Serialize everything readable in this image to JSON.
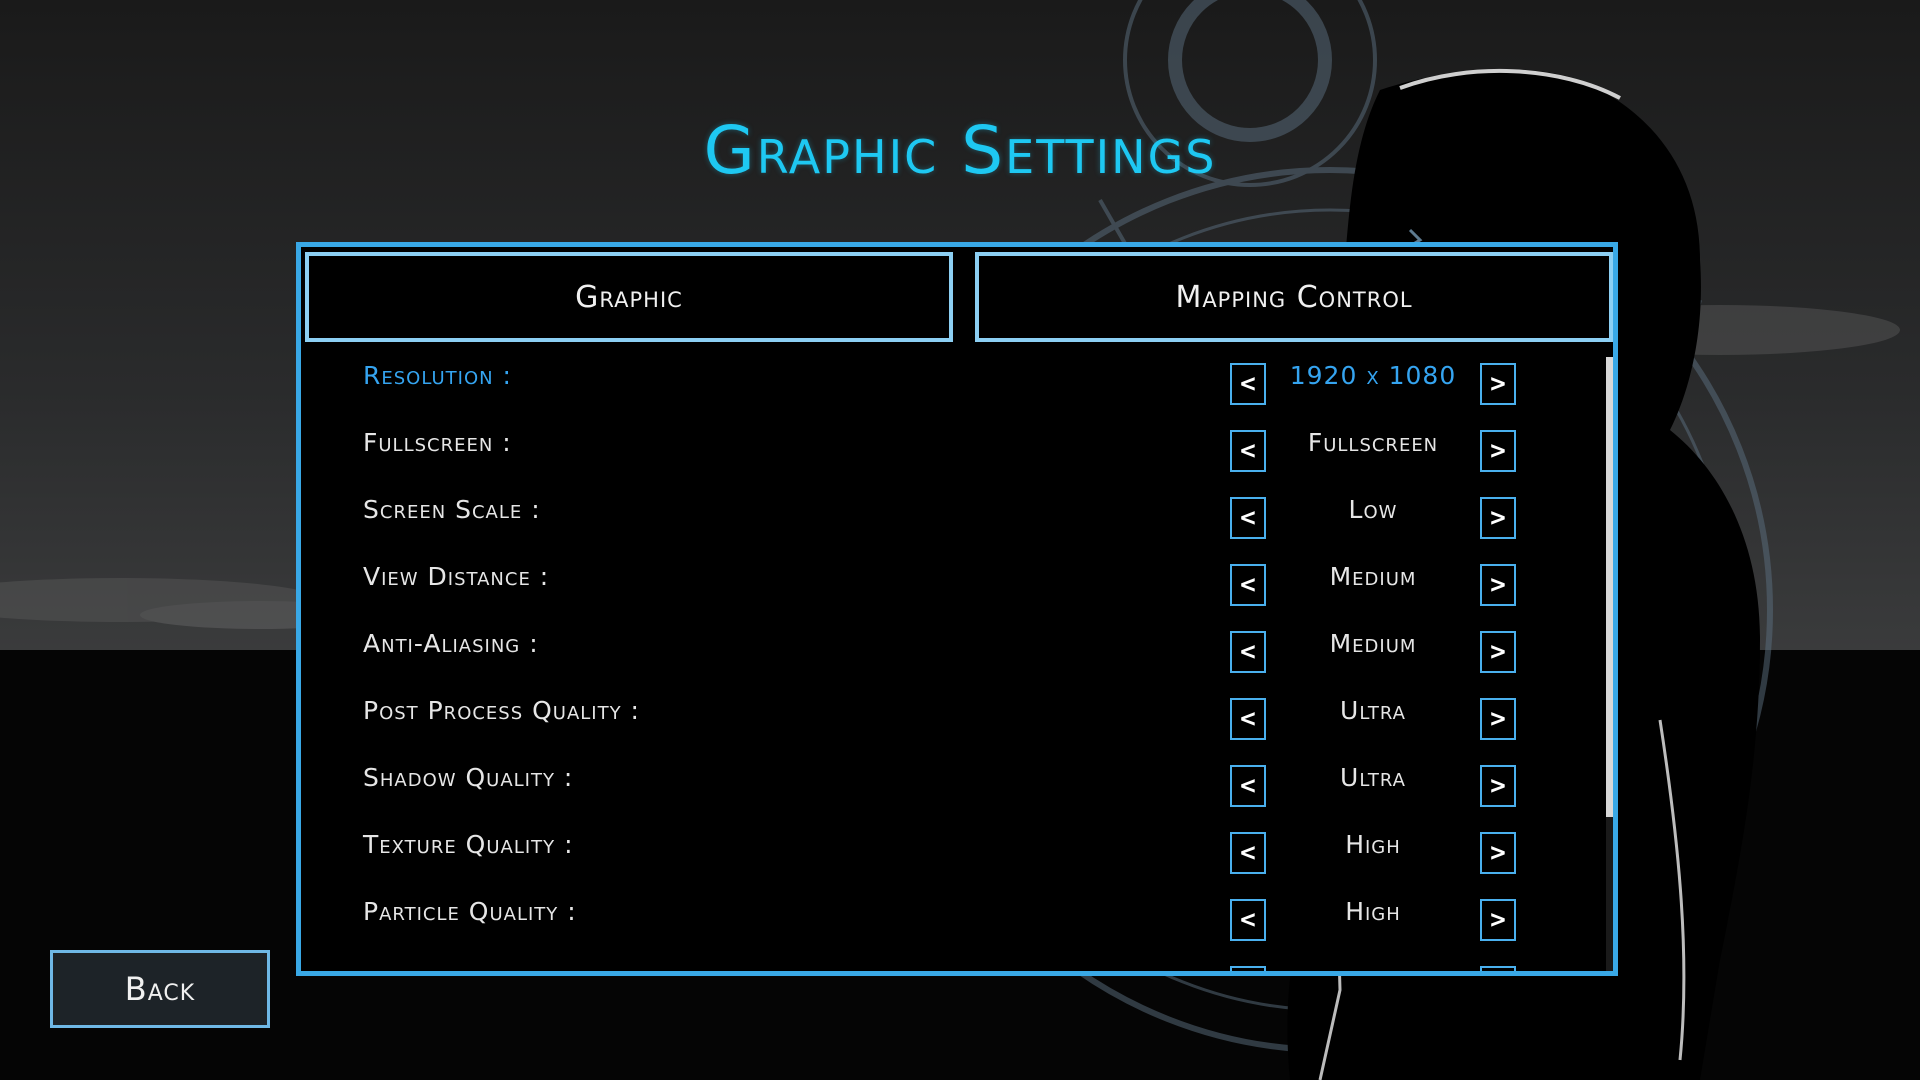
{
  "title": "Graphic Settings",
  "tabs": [
    {
      "label": "Graphic"
    },
    {
      "label": "Mapping Control"
    }
  ],
  "arrows": {
    "left": "<",
    "right": ">"
  },
  "settings": [
    {
      "label": "Resolution :",
      "value": "1920 x 1080"
    },
    {
      "label": "Fullscreen :",
      "value": "Fullscreen"
    },
    {
      "label": "Screen Scale :",
      "value": "Low"
    },
    {
      "label": "View Distance :",
      "value": "Medium"
    },
    {
      "label": "Anti-Aliasing :",
      "value": "Medium"
    },
    {
      "label": "Post Process Quality :",
      "value": "Ultra"
    },
    {
      "label": "Shadow Quality :",
      "value": "Ultra"
    },
    {
      "label": "Texture Quality :",
      "value": "High"
    },
    {
      "label": "Particle Quality :",
      "value": "High"
    }
  ],
  "back_label": "Back",
  "colors": {
    "accent": "#1ec8f2",
    "panel_border": "#39a8e6",
    "active_row": "#35a4f0",
    "back_button_bg": "#1d2328"
  }
}
